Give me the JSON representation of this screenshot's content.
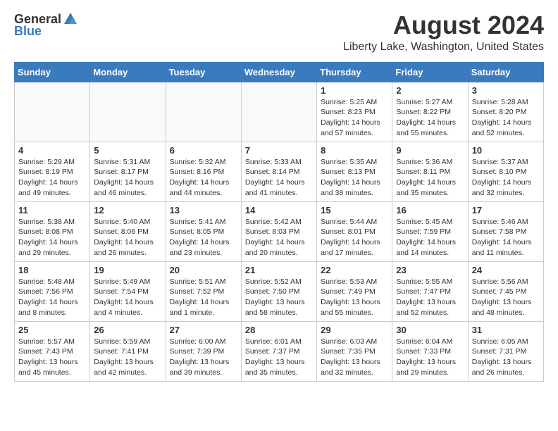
{
  "header": {
    "logo_general": "General",
    "logo_blue": "Blue",
    "month_title": "August 2024",
    "location": "Liberty Lake, Washington, United States"
  },
  "days_of_week": [
    "Sunday",
    "Monday",
    "Tuesday",
    "Wednesday",
    "Thursday",
    "Friday",
    "Saturday"
  ],
  "weeks": [
    [
      {
        "day": "",
        "info": ""
      },
      {
        "day": "",
        "info": ""
      },
      {
        "day": "",
        "info": ""
      },
      {
        "day": "",
        "info": ""
      },
      {
        "day": "1",
        "info": "Sunrise: 5:25 AM\nSunset: 8:23 PM\nDaylight: 14 hours\nand 57 minutes."
      },
      {
        "day": "2",
        "info": "Sunrise: 5:27 AM\nSunset: 8:22 PM\nDaylight: 14 hours\nand 55 minutes."
      },
      {
        "day": "3",
        "info": "Sunrise: 5:28 AM\nSunset: 8:20 PM\nDaylight: 14 hours\nand 52 minutes."
      }
    ],
    [
      {
        "day": "4",
        "info": "Sunrise: 5:29 AM\nSunset: 8:19 PM\nDaylight: 14 hours\nand 49 minutes."
      },
      {
        "day": "5",
        "info": "Sunrise: 5:31 AM\nSunset: 8:17 PM\nDaylight: 14 hours\nand 46 minutes."
      },
      {
        "day": "6",
        "info": "Sunrise: 5:32 AM\nSunset: 8:16 PM\nDaylight: 14 hours\nand 44 minutes."
      },
      {
        "day": "7",
        "info": "Sunrise: 5:33 AM\nSunset: 8:14 PM\nDaylight: 14 hours\nand 41 minutes."
      },
      {
        "day": "8",
        "info": "Sunrise: 5:35 AM\nSunset: 8:13 PM\nDaylight: 14 hours\nand 38 minutes."
      },
      {
        "day": "9",
        "info": "Sunrise: 5:36 AM\nSunset: 8:11 PM\nDaylight: 14 hours\nand 35 minutes."
      },
      {
        "day": "10",
        "info": "Sunrise: 5:37 AM\nSunset: 8:10 PM\nDaylight: 14 hours\nand 32 minutes."
      }
    ],
    [
      {
        "day": "11",
        "info": "Sunrise: 5:38 AM\nSunset: 8:08 PM\nDaylight: 14 hours\nand 29 minutes."
      },
      {
        "day": "12",
        "info": "Sunrise: 5:40 AM\nSunset: 8:06 PM\nDaylight: 14 hours\nand 26 minutes."
      },
      {
        "day": "13",
        "info": "Sunrise: 5:41 AM\nSunset: 8:05 PM\nDaylight: 14 hours\nand 23 minutes."
      },
      {
        "day": "14",
        "info": "Sunrise: 5:42 AM\nSunset: 8:03 PM\nDaylight: 14 hours\nand 20 minutes."
      },
      {
        "day": "15",
        "info": "Sunrise: 5:44 AM\nSunset: 8:01 PM\nDaylight: 14 hours\nand 17 minutes."
      },
      {
        "day": "16",
        "info": "Sunrise: 5:45 AM\nSunset: 7:59 PM\nDaylight: 14 hours\nand 14 minutes."
      },
      {
        "day": "17",
        "info": "Sunrise: 5:46 AM\nSunset: 7:58 PM\nDaylight: 14 hours\nand 11 minutes."
      }
    ],
    [
      {
        "day": "18",
        "info": "Sunrise: 5:48 AM\nSunset: 7:56 PM\nDaylight: 14 hours\nand 8 minutes."
      },
      {
        "day": "19",
        "info": "Sunrise: 5:49 AM\nSunset: 7:54 PM\nDaylight: 14 hours\nand 4 minutes."
      },
      {
        "day": "20",
        "info": "Sunrise: 5:51 AM\nSunset: 7:52 PM\nDaylight: 14 hours\nand 1 minute."
      },
      {
        "day": "21",
        "info": "Sunrise: 5:52 AM\nSunset: 7:50 PM\nDaylight: 13 hours\nand 58 minutes."
      },
      {
        "day": "22",
        "info": "Sunrise: 5:53 AM\nSunset: 7:49 PM\nDaylight: 13 hours\nand 55 minutes."
      },
      {
        "day": "23",
        "info": "Sunrise: 5:55 AM\nSunset: 7:47 PM\nDaylight: 13 hours\nand 52 minutes."
      },
      {
        "day": "24",
        "info": "Sunrise: 5:56 AM\nSunset: 7:45 PM\nDaylight: 13 hours\nand 48 minutes."
      }
    ],
    [
      {
        "day": "25",
        "info": "Sunrise: 5:57 AM\nSunset: 7:43 PM\nDaylight: 13 hours\nand 45 minutes."
      },
      {
        "day": "26",
        "info": "Sunrise: 5:59 AM\nSunset: 7:41 PM\nDaylight: 13 hours\nand 42 minutes."
      },
      {
        "day": "27",
        "info": "Sunrise: 6:00 AM\nSunset: 7:39 PM\nDaylight: 13 hours\nand 39 minutes."
      },
      {
        "day": "28",
        "info": "Sunrise: 6:01 AM\nSunset: 7:37 PM\nDaylight: 13 hours\nand 35 minutes."
      },
      {
        "day": "29",
        "info": "Sunrise: 6:03 AM\nSunset: 7:35 PM\nDaylight: 13 hours\nand 32 minutes."
      },
      {
        "day": "30",
        "info": "Sunrise: 6:04 AM\nSunset: 7:33 PM\nDaylight: 13 hours\nand 29 minutes."
      },
      {
        "day": "31",
        "info": "Sunrise: 6:05 AM\nSunset: 7:31 PM\nDaylight: 13 hours\nand 26 minutes."
      }
    ]
  ]
}
